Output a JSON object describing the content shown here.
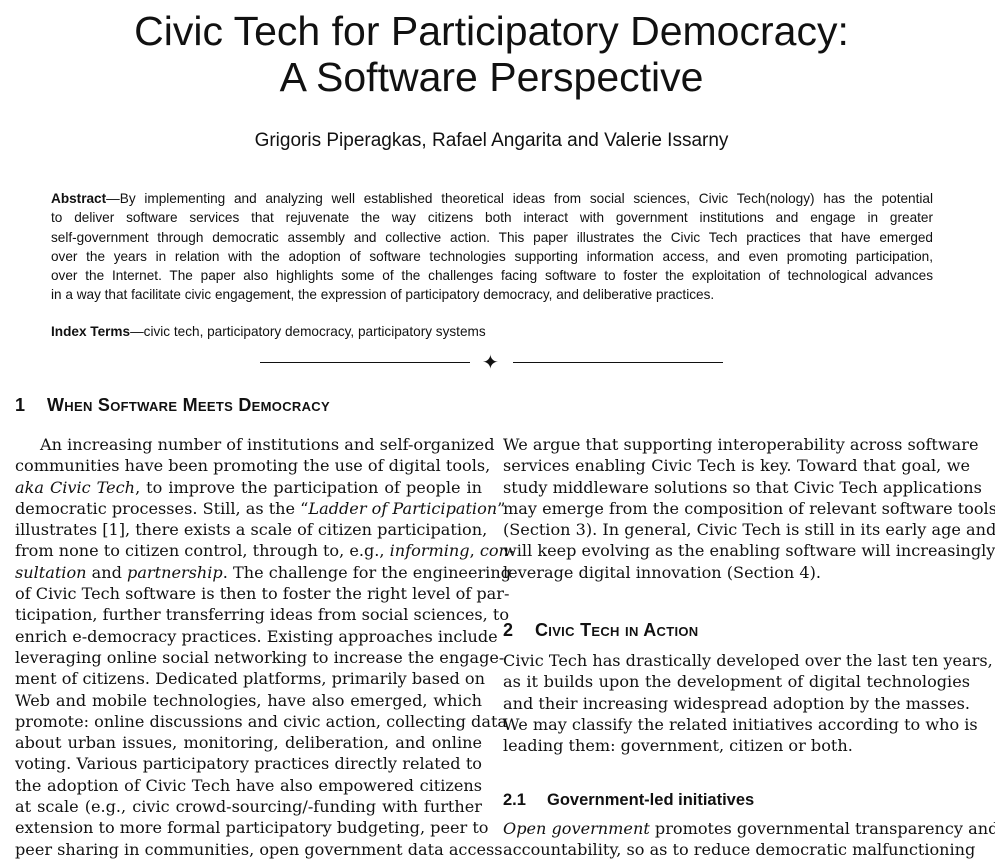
{
  "title": {
    "line1": "Civic Tech for Participatory Democracy:",
    "line2": "A Software Perspective"
  },
  "authors": "Grigoris Piperagkas, Rafael Angarita and Valerie Issarny",
  "abstract": {
    "label": "Abstract",
    "lines": [
      "—By implementing and analyzing well established theoretical ideas from social sciences, Civic Tech(nology) has the potential",
      "to deliver software services that rejuvenate the way citizens both interact with government institutions and engage in greater",
      "self-government through democratic assembly and collective action. This paper illustrates the Civic Tech practices that have emerged",
      "over the years in relation with the adoption of software technologies supporting information access, and even promoting participation,",
      "over the Internet. The paper also highlights some of the challenges facing software to foster the exploitation of technological advances",
      "in a way that facilitate civic engagement, the expression of participatory democracy, and deliberative practices."
    ]
  },
  "index_terms": {
    "label": "Index Terms",
    "text": "—civic tech, participatory democracy, participatory systems"
  },
  "divider_icon": "four-pointed-star-icon",
  "section1": {
    "number": "1",
    "title": "When Software Meets Democracy"
  },
  "left_column": [
    [
      [
        "An increasing number of institutions and self-organized",
        false
      ]
    ],
    [
      [
        "communities have been promoting the use of digital tools,",
        false
      ]
    ],
    [
      [
        "aka Civic Tech",
        true
      ],
      [
        ", to improve the participation of people in",
        false
      ]
    ],
    [
      [
        "democratic processes. Still, as the “",
        false
      ],
      [
        "Ladder of Participation",
        true
      ],
      [
        "”",
        false
      ]
    ],
    [
      [
        "illustrates [1], there exists a scale of citizen participation,",
        false
      ]
    ],
    [
      [
        "from none to citizen control, through to, e.g., ",
        false
      ],
      [
        "informing",
        true
      ],
      [
        ", ",
        false
      ],
      [
        "con-",
        true
      ]
    ],
    [
      [
        "sultation",
        true
      ],
      [
        " and ",
        false
      ],
      [
        "partnership",
        true
      ],
      [
        ". The challenge for the engineering",
        false
      ]
    ],
    [
      [
        "of Civic Tech software is then to foster the right level of par-",
        false
      ]
    ],
    [
      [
        "ticipation, further transferring ideas from social sciences, to",
        false
      ]
    ],
    [
      [
        "enrich e-democracy practices. Existing approaches include",
        false
      ]
    ],
    [
      [
        "leveraging online social networking to increase the engage-",
        false
      ]
    ],
    [
      [
        "ment of citizens. Dedicated platforms, primarily based on",
        false
      ]
    ],
    [
      [
        "Web and mobile technologies, have also emerged, which",
        false
      ]
    ],
    [
      [
        "promote: online discussions and civic action, collecting data",
        false
      ]
    ],
    [
      [
        "about urban issues, monitoring, deliberation, and online",
        false
      ]
    ],
    [
      [
        "voting. Various participatory practices directly related to",
        false
      ]
    ],
    [
      [
        "the adoption of Civic Tech have also empowered citizens",
        false
      ]
    ],
    [
      [
        "at scale (e.g., civic crowd-sourcing/-funding with further",
        false
      ]
    ],
    [
      [
        "extension to more formal participatory budgeting, peer to",
        false
      ]
    ],
    [
      [
        "peer sharing in communities, open government data access",
        false
      ]
    ]
  ],
  "right_column_intro": [
    [
      [
        "We argue that supporting interoperability across software",
        false
      ]
    ],
    [
      [
        "services enabling Civic Tech is key. Toward that goal, we",
        false
      ]
    ],
    [
      [
        "study middleware solutions so that Civic Tech applications",
        false
      ]
    ],
    [
      [
        "may emerge from the composition of relevant software tools",
        false
      ]
    ],
    [
      [
        "(Section 3). In general, Civic Tech is still in its early age and",
        false
      ]
    ],
    [
      [
        "will keep evolving as the enabling software will increasingly",
        false
      ]
    ],
    [
      [
        "leverage digital innovation (Section 4).",
        false
      ]
    ]
  ],
  "section2": {
    "number": "2",
    "title": "Civic Tech in Action"
  },
  "section2_text": [
    [
      [
        "Civic Tech has drastically developed over the last ten years,",
        false
      ]
    ],
    [
      [
        "as it builds upon the development of digital technologies",
        false
      ]
    ],
    [
      [
        "and their increasing widespread adoption by the masses.",
        false
      ]
    ],
    [
      [
        "We may classify the related initiatives according to who is",
        false
      ]
    ],
    [
      [
        "leading them: government, citizen or both.",
        false
      ]
    ]
  ],
  "subsection21": {
    "number": "2.1",
    "title": "Government-led initiatives"
  },
  "subsection21_text": [
    [
      [
        "Open government",
        true
      ],
      [
        " promotes governmental transparency and",
        false
      ]
    ],
    [
      [
        "accountability, so as to reduce democratic malfunctioning",
        false
      ]
    ]
  ]
}
